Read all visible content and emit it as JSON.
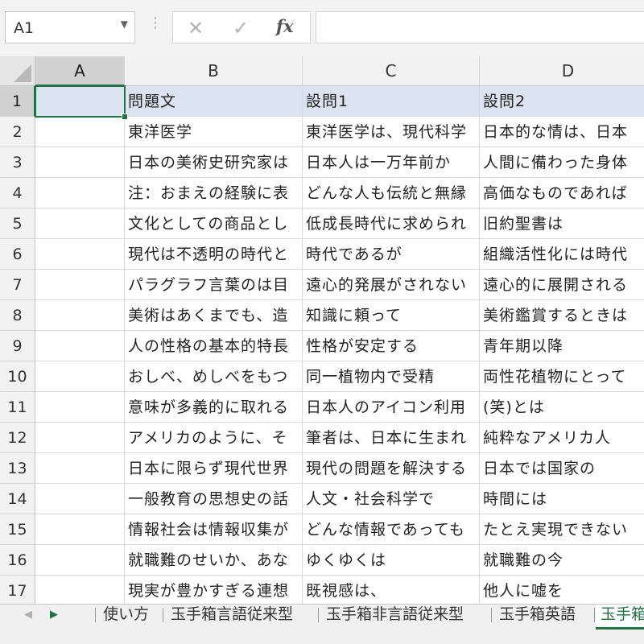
{
  "formula_bar": {
    "name_box": "A1",
    "cancel_glyph": "✕",
    "confirm_glyph": "✓",
    "function_glyph": "fx",
    "formula": ""
  },
  "columns": [
    "A",
    "B",
    "C",
    "D"
  ],
  "rows": [
    {
      "num": "1",
      "cells": [
        "",
        "問題文",
        "設問1",
        "設問2"
      ]
    },
    {
      "num": "2",
      "cells": [
        "",
        "東洋医学",
        "東洋医学は、現代科学",
        "日本的な情は、日本"
      ]
    },
    {
      "num": "3",
      "cells": [
        "",
        "日本の美術史研究家は",
        "日本人は一万年前か",
        "人間に備わった身体"
      ]
    },
    {
      "num": "4",
      "cells": [
        "",
        "注：おまえの経験に表",
        "どんな人も伝統と無縁",
        "高価なものであれば"
      ]
    },
    {
      "num": "5",
      "cells": [
        "",
        "文化としての商品とし",
        "低成長時代に求められ",
        "旧約聖書は"
      ]
    },
    {
      "num": "6",
      "cells": [
        "",
        "現代は不透明の時代と",
        "時代であるが",
        "組織活性化には時代"
      ]
    },
    {
      "num": "7",
      "cells": [
        "",
        "パラグラフ言葉のは目",
        "遠心的発展がされない",
        "遠心的に展開される"
      ]
    },
    {
      "num": "8",
      "cells": [
        "",
        "美術はあくまでも、造",
        "知識に頼って",
        "美術鑑賞するときは"
      ]
    },
    {
      "num": "9",
      "cells": [
        "",
        "人の性格の基本的特長",
        "性格が安定する",
        "青年期以降"
      ]
    },
    {
      "num": "10",
      "cells": [
        "",
        "おしべ、めしべをもつ",
        "同一植物内で受精",
        "両性花植物にとって"
      ]
    },
    {
      "num": "11",
      "cells": [
        "",
        "意味が多義的に取れる",
        "日本人のアイコン利用",
        "(笑)とは"
      ]
    },
    {
      "num": "12",
      "cells": [
        "",
        "アメリカのように、そ",
        "筆者は、日本に生まれ",
        "純粋なアメリカ人"
      ]
    },
    {
      "num": "13",
      "cells": [
        "",
        "日本に限らず現代世界",
        "現代の問題を解決する",
        "日本では国家の"
      ]
    },
    {
      "num": "14",
      "cells": [
        "",
        "一般教育の思想史の話",
        "人文・社会科学で",
        "時間には"
      ]
    },
    {
      "num": "15",
      "cells": [
        "",
        "情報社会は情報収集が",
        "どんな情報であっても",
        "たとえ実現できない"
      ]
    },
    {
      "num": "16",
      "cells": [
        "",
        "就職難のせいか、あな",
        "ゆくゆくは",
        "就職難の今"
      ]
    },
    {
      "num": "17",
      "cells": [
        "",
        "現実が豊かすぎる連想",
        "既視感は、",
        "他人に嘘を"
      ]
    }
  ],
  "sheet_tabs": {
    "nav_prev": "◀",
    "nav_next": "▶",
    "tabs": [
      "使い方",
      "玉手箱言語従来型",
      "玉手箱非言語従来型",
      "玉手箱英語",
      "玉手箱"
    ],
    "active_index": 4
  },
  "colors": {
    "accent": "#217346",
    "row1_fill": "#dce3f1"
  }
}
